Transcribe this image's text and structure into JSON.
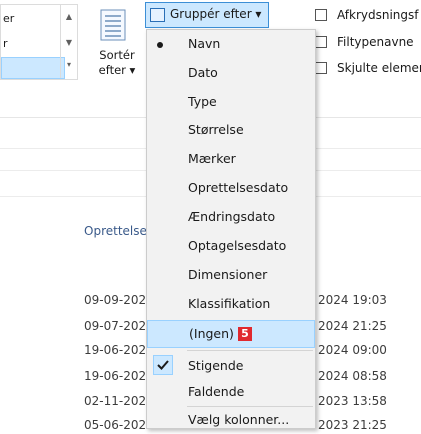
{
  "ribbon": {
    "view_list": {
      "items": [
        "er",
        "r",
        ""
      ],
      "selected_index": 2
    },
    "sort_by": {
      "label_line1": "Sortér",
      "label_line2": "efter ▾"
    },
    "group_by": {
      "label": "Gruppér efter ▾"
    },
    "checkboxes": [
      {
        "label": "Afkrydsningsf",
        "checked": false
      },
      {
        "label": "Filtypenavne",
        "checked": false
      },
      {
        "label": "Skjulte elemer",
        "checked": false
      }
    ]
  },
  "file_list": {
    "column_header": "Oprettelse",
    "left_dates": [
      "09-09-202",
      "09-07-202",
      "19-06-202",
      "19-06-202",
      "02-11-202",
      "05-06-202"
    ],
    "right_dates": [
      "2024 19:03",
      "2024 21:25",
      "2024 09:00",
      "2024 08:58",
      "2023 13:58",
      "2023 21:25"
    ]
  },
  "group_menu": {
    "items": [
      {
        "label": "Navn",
        "selected": true
      },
      {
        "label": "Dato",
        "selected": false
      },
      {
        "label": "Type",
        "selected": false
      },
      {
        "label": "Størrelse",
        "selected": false
      },
      {
        "label": "Mærker",
        "selected": false
      },
      {
        "label": "Oprettelsesdato",
        "selected": false
      },
      {
        "label": "Ændringsdato",
        "selected": false
      },
      {
        "label": "Optagelsesdato",
        "selected": false
      },
      {
        "label": "Dimensioner",
        "selected": false
      },
      {
        "label": "Klassifikation",
        "selected": false
      },
      {
        "label": "(Ingen)",
        "selected": false,
        "hovered": true,
        "badge": "5"
      }
    ],
    "order_items": [
      {
        "label": "Stigende",
        "checked": true
      },
      {
        "label": "Faldende",
        "checked": false
      }
    ],
    "choose_columns": "Vælg kolonner...",
    "colors": {
      "hover_bg": "#cce8ff",
      "hover_border": "#99d1ff",
      "badge": "#e0292f"
    }
  }
}
